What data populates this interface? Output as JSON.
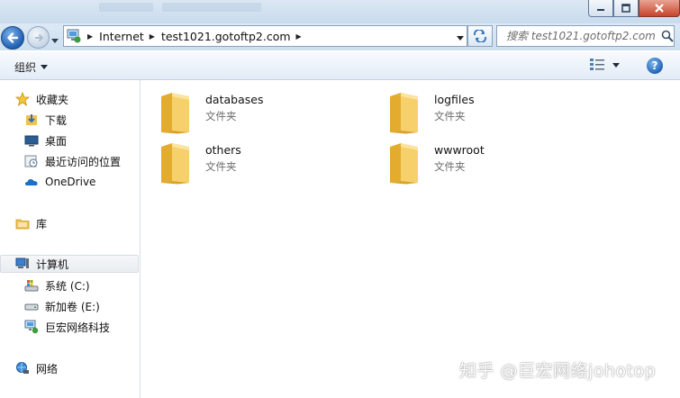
{
  "window": {
    "caption_buttons": [
      "minimize",
      "maximize",
      "close"
    ]
  },
  "address_bar": {
    "breadcrumbs": [
      "Internet",
      "test1021.gotoftp2.com"
    ],
    "search_placeholder": "搜索 test1021.gotoftp2.com"
  },
  "toolbar": {
    "organize_label": "组织"
  },
  "nav": {
    "favorites": {
      "label": "收藏夹",
      "items": [
        {
          "label": "下载",
          "icon": "download-icon"
        },
        {
          "label": "桌面",
          "icon": "desktop-icon"
        },
        {
          "label": "最近访问的位置",
          "icon": "recent-places-icon"
        },
        {
          "label": "OneDrive",
          "icon": "onedrive-icon"
        }
      ]
    },
    "libraries": {
      "label": "库"
    },
    "computer": {
      "label": "计算机",
      "items": [
        {
          "label": "系统 (C:)",
          "icon": "system-drive-icon"
        },
        {
          "label": "新加卷 (E:)",
          "icon": "drive-icon"
        },
        {
          "label": "巨宏网络科技",
          "icon": "network-location-icon"
        }
      ]
    },
    "network": {
      "label": "网络"
    }
  },
  "folders": [
    {
      "name": "databases",
      "type": "文件夹"
    },
    {
      "name": "logfiles",
      "type": "文件夹"
    },
    {
      "name": "others",
      "type": "文件夹"
    },
    {
      "name": "wwwroot",
      "type": "文件夹"
    }
  ],
  "watermark": "知乎 @巨宏网络johotop",
  "colors": {
    "chrome": "#cddff0",
    "accent": "#1c5fb0",
    "folder": "#f2c14e"
  }
}
